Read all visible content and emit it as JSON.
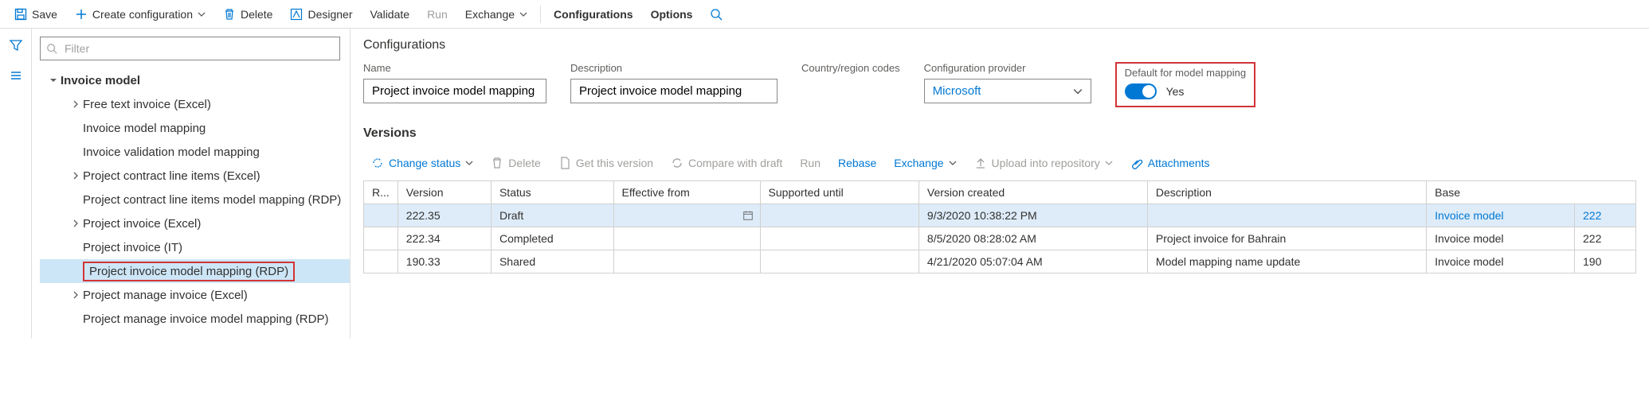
{
  "toolbar": {
    "save": "Save",
    "create_config": "Create configuration",
    "delete": "Delete",
    "designer": "Designer",
    "validate": "Validate",
    "run": "Run",
    "exchange": "Exchange",
    "configurations": "Configurations",
    "options": "Options"
  },
  "filter": {
    "placeholder": "Filter"
  },
  "tree": {
    "root": "Invoice model",
    "items": [
      {
        "label": "Free text invoice (Excel)",
        "caret": true
      },
      {
        "label": "Invoice model mapping",
        "caret": false
      },
      {
        "label": "Invoice validation model mapping",
        "caret": false
      },
      {
        "label": "Project contract line items (Excel)",
        "caret": true
      },
      {
        "label": "Project contract line items model mapping (RDP)",
        "caret": false
      },
      {
        "label": "Project invoice (Excel)",
        "caret": true
      },
      {
        "label": "Project invoice (IT)",
        "caret": false
      },
      {
        "label": "Project invoice model mapping (RDP)",
        "caret": false,
        "selected": true,
        "highlighted": true
      },
      {
        "label": "Project manage invoice (Excel)",
        "caret": true
      },
      {
        "label": "Project manage invoice model mapping (RDP)",
        "caret": false
      }
    ]
  },
  "details": {
    "title": "Configurations",
    "name_label": "Name",
    "name_value": "Project invoice model mapping",
    "description_label": "Description",
    "description_value": "Project invoice model mapping",
    "country_label": "Country/region codes",
    "provider_label": "Configuration provider",
    "provider_value": "Microsoft",
    "default_label": "Default for model mapping",
    "default_value": "Yes"
  },
  "versions": {
    "title": "Versions",
    "toolbar": {
      "change_status": "Change status",
      "delete": "Delete",
      "get_version": "Get this version",
      "compare": "Compare with draft",
      "run": "Run",
      "rebase": "Rebase",
      "exchange": "Exchange",
      "upload": "Upload into repository",
      "attachments": "Attachments"
    },
    "headers": {
      "r": "R...",
      "version": "Version",
      "status": "Status",
      "effective_from": "Effective from",
      "supported_until": "Supported until",
      "created": "Version created",
      "description": "Description",
      "base": "Base"
    },
    "rows": [
      {
        "version": "222.35",
        "status": "Draft",
        "created": "9/3/2020 10:38:22 PM",
        "description": "",
        "base": "Invoice model",
        "base_num": "222",
        "selected": true
      },
      {
        "version": "222.34",
        "status": "Completed",
        "created": "8/5/2020 08:28:02 AM",
        "description": "Project invoice for Bahrain",
        "base": "Invoice model",
        "base_num": "222"
      },
      {
        "version": "190.33",
        "status": "Shared",
        "created": "4/21/2020 05:07:04 AM",
        "description": "Model mapping name update",
        "base": "Invoice model",
        "base_num": "190"
      }
    ]
  }
}
